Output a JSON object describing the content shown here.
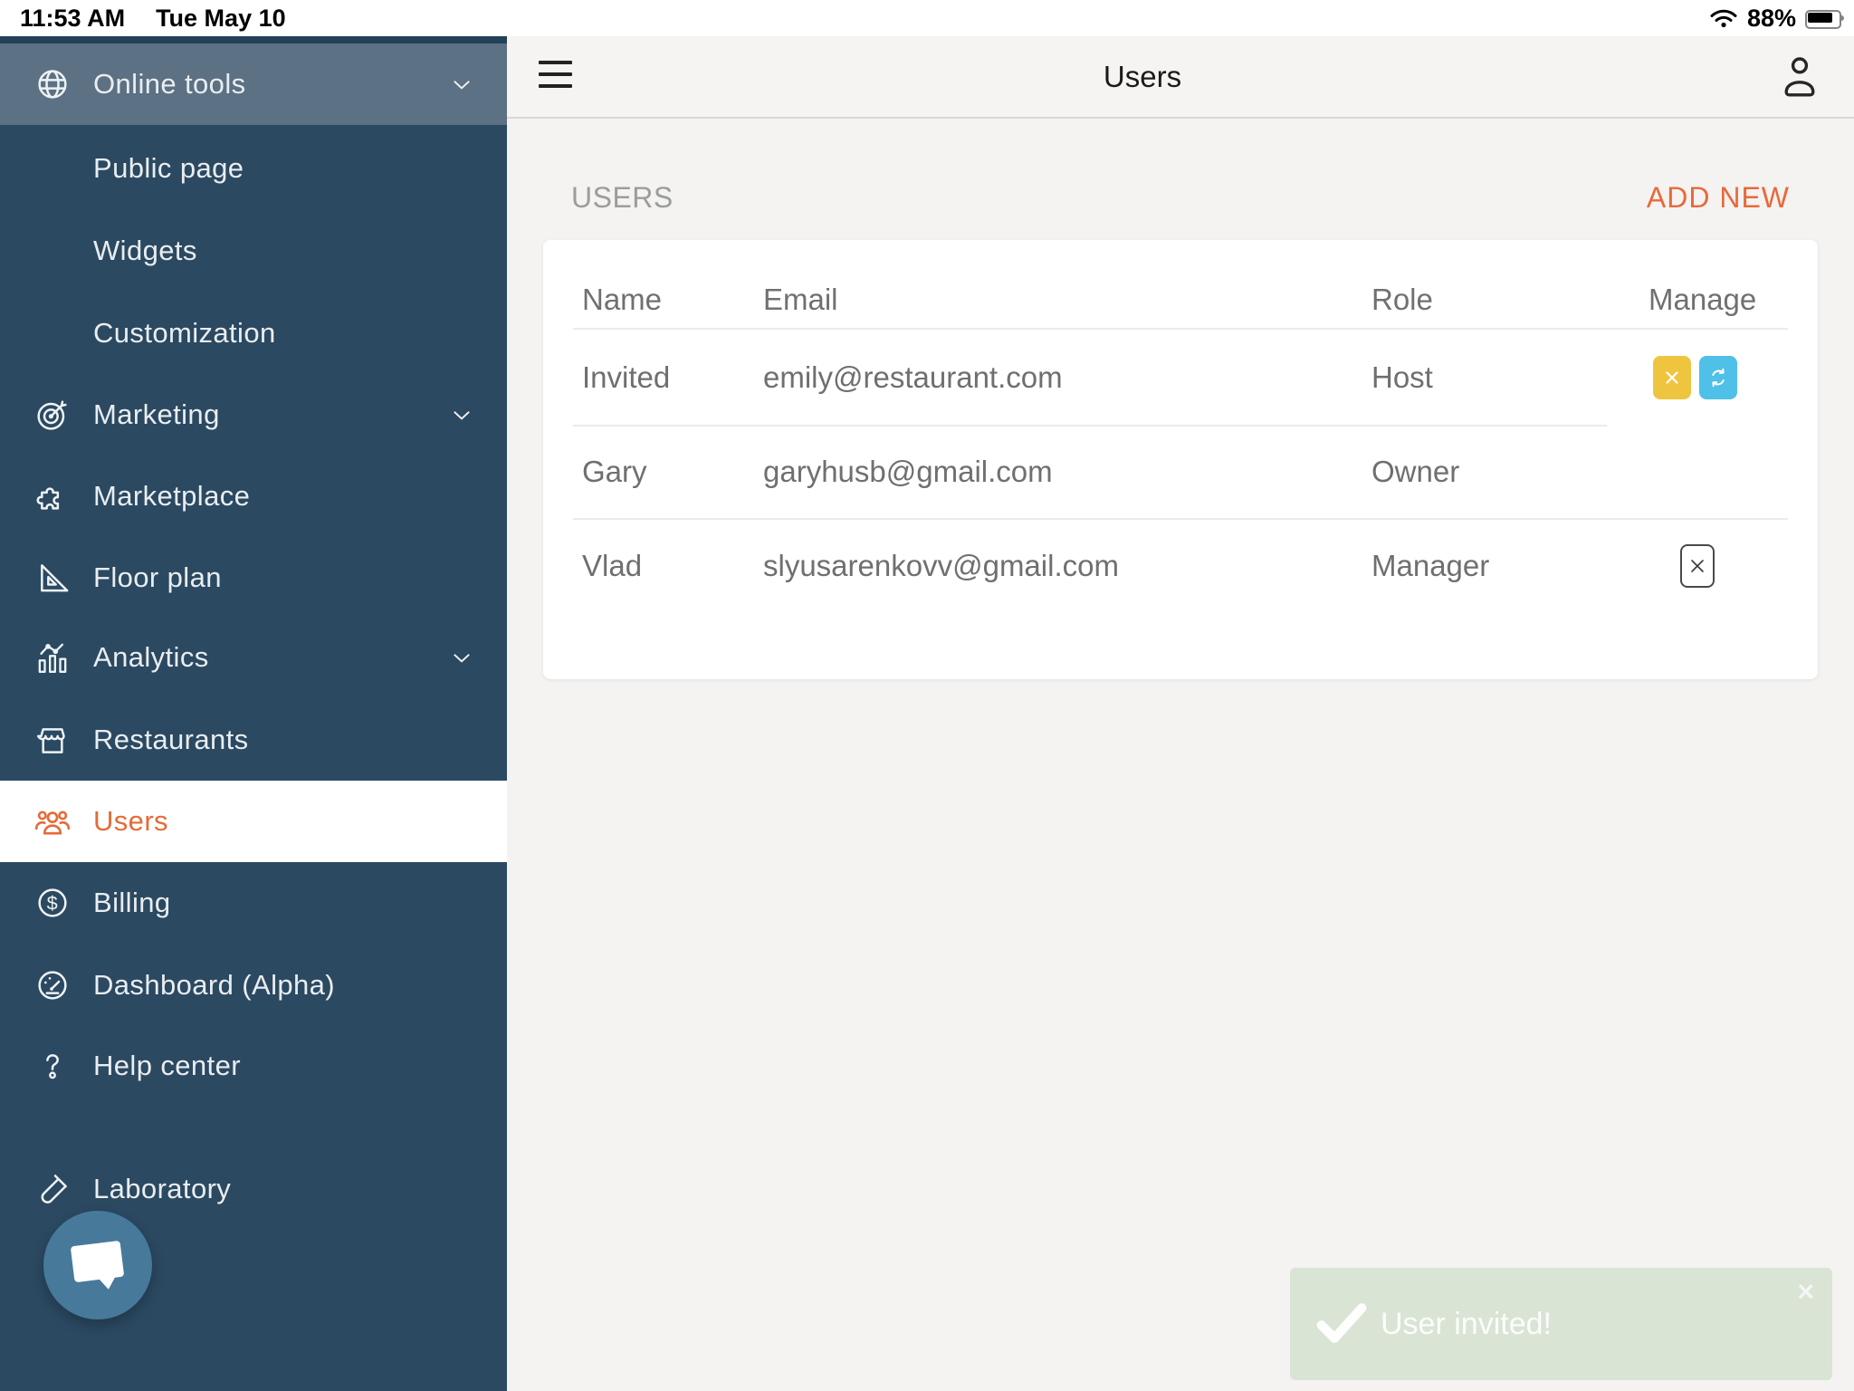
{
  "status_bar": {
    "time": "11:53 AM",
    "date": "Tue May 10",
    "battery_percent": "88%"
  },
  "sidebar": {
    "items": [
      {
        "label": "Online tools",
        "icon": "globe-icon",
        "state": "expanded-parent"
      },
      {
        "label": "Public page",
        "icon": null,
        "state": "sub-item"
      },
      {
        "label": "Widgets",
        "icon": null,
        "state": "sub-item"
      },
      {
        "label": "Customization",
        "icon": null,
        "state": "sub-item"
      },
      {
        "label": "Marketing",
        "icon": "target-icon",
        "state": "collapsible"
      },
      {
        "label": "Marketplace",
        "icon": "puzzle-icon",
        "state": "normal"
      },
      {
        "label": "Floor plan",
        "icon": "set-square-icon",
        "state": "normal"
      },
      {
        "label": "Analytics",
        "icon": "bar-chart-icon",
        "state": "collapsible"
      },
      {
        "label": "Restaurants",
        "icon": "storefront-icon",
        "state": "normal"
      },
      {
        "label": "Users",
        "icon": "users-icon",
        "state": "active"
      },
      {
        "label": "Billing",
        "icon": "dollar-icon",
        "state": "normal"
      },
      {
        "label": "Dashboard (Alpha)",
        "icon": "gauge-icon",
        "state": "normal"
      },
      {
        "label": "Help center",
        "icon": "question-icon",
        "state": "normal"
      },
      {
        "label": "Laboratory",
        "icon": "test-tube-icon",
        "state": "normal"
      }
    ]
  },
  "topbar": {
    "title": "Users"
  },
  "content": {
    "section_title": "USERS",
    "add_new_label": "ADD NEW",
    "table": {
      "headers": [
        "Name",
        "Email",
        "Role",
        "Manage"
      ],
      "rows": [
        {
          "name": "Invited",
          "email": "emily@restaurant.com",
          "role": "Host",
          "actions": [
            "cancel-invite",
            "resend-invite"
          ]
        },
        {
          "name": "Gary",
          "email": "garyhusb@gmail.com",
          "role": "Owner",
          "actions": []
        },
        {
          "name": "Vlad",
          "email": "slyusarenkovv@gmail.com",
          "role": "Manager",
          "actions": [
            "remove-user"
          ]
        }
      ]
    }
  },
  "toast": {
    "message": "User invited!",
    "icon": "check-icon",
    "close_symbol": "×"
  },
  "colors": {
    "sidebar_bg": "#2b4961",
    "sidebar_top_strip": "#22425a",
    "sidebar_selected_parent_bg": "#5c7183",
    "active_orange": "#e66a38",
    "add_new_orange": "#e7693c",
    "topbar_bg": "#f5f4f2",
    "content_bg": "#f4f3f1",
    "card_bg": "#ffffff",
    "table_text": "#6f6f6f",
    "section_title_gray": "#9c9c9c",
    "yellow_button": "#efc53f",
    "blue_button": "#4fc0e8",
    "toast_bg": "#d9e4d4",
    "chat_fab_bg": "#47799b"
  }
}
